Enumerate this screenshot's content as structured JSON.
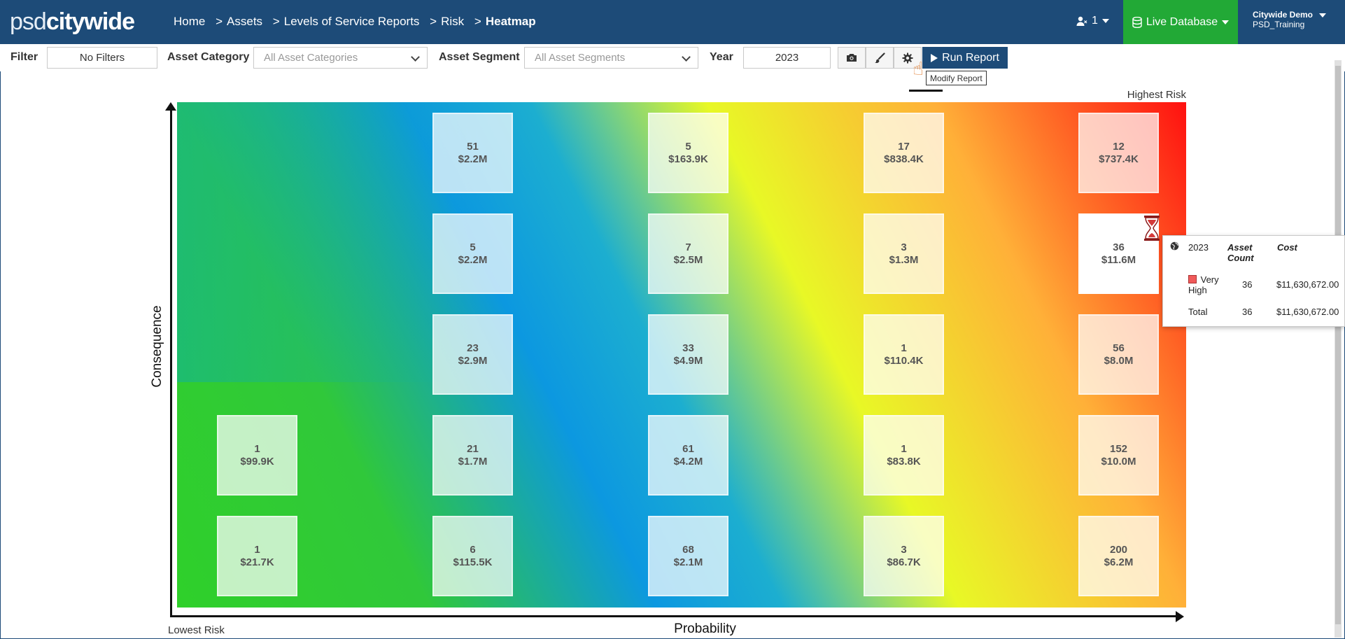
{
  "header": {
    "logo_part1": "psd",
    "logo_part2": "citywide",
    "breadcrumbs": [
      {
        "label": "Home"
      },
      {
        "label": "Assets"
      },
      {
        "label": "Levels of Service Reports"
      },
      {
        "label": "Risk"
      },
      {
        "label": "Heatmap"
      }
    ],
    "crumb_sep": ">",
    "user_count": "1",
    "database_label": "Live Database",
    "account_name": "Citywide Demo",
    "account_sub": "PSD_Training"
  },
  "toolbar": {
    "filter_label": "Filter",
    "filter_value": "No Filters",
    "asset_category_label": "Asset Category",
    "asset_category_placeholder": "All Asset Categories",
    "asset_segment_label": "Asset Segment",
    "asset_segment_placeholder": "All Asset Segments",
    "year_label": "Year",
    "year_value": "2023",
    "run_report_label": "Run Report",
    "tooltip": "Modify Report"
  },
  "heatmap": {
    "y_axis_label": "Consequence",
    "x_axis_label": "Probability",
    "highest_label": "Highest Risk",
    "lowest_label": "Lowest Risk",
    "rows": [
      [
        null,
        {
          "count": "51",
          "cost": "$2.2M"
        },
        {
          "count": "5",
          "cost": "$163.9K"
        },
        {
          "count": "17",
          "cost": "$838.4K"
        },
        {
          "count": "12",
          "cost": "$737.4K"
        }
      ],
      [
        null,
        {
          "count": "5",
          "cost": "$2.2M"
        },
        {
          "count": "7",
          "cost": "$2.5M"
        },
        {
          "count": "3",
          "cost": "$1.3M"
        },
        {
          "count": "36",
          "cost": "$11.6M",
          "highlighted": true
        }
      ],
      [
        null,
        {
          "count": "23",
          "cost": "$2.9M"
        },
        {
          "count": "33",
          "cost": "$4.9M"
        },
        {
          "count": "1",
          "cost": "$110.4K"
        },
        {
          "count": "56",
          "cost": "$8.0M"
        }
      ],
      [
        {
          "count": "1",
          "cost": "$99.9K"
        },
        {
          "count": "21",
          "cost": "$1.7M"
        },
        {
          "count": "61",
          "cost": "$4.2M"
        },
        {
          "count": "1",
          "cost": "$83.8K"
        },
        {
          "count": "152",
          "cost": "$10.0M"
        }
      ],
      [
        {
          "count": "1",
          "cost": "$21.7K"
        },
        {
          "count": "6",
          "cost": "$115.5K"
        },
        {
          "count": "68",
          "cost": "$2.1M"
        },
        {
          "count": "3",
          "cost": "$86.7K"
        },
        {
          "count": "200",
          "cost": "$6.2M"
        }
      ]
    ]
  },
  "popup": {
    "year": "2023",
    "col_count_line1": "Asset",
    "col_count_line2": "Count",
    "col_cost": "Cost",
    "row_label_line1": "Very",
    "row_label_line2": "High",
    "row_color": "#f05a5a",
    "row_count": "36",
    "row_cost": "$11,630,672.00",
    "total_label": "Total",
    "total_count": "36",
    "total_cost": "$11,630,672.00"
  },
  "icons": {
    "camera": "camera-icon",
    "brush": "brush-icon",
    "gear": "gear-icon",
    "play": "play-icon",
    "database": "database-icon",
    "user": "user-icon",
    "globe": "globe-icon",
    "hourglass": "hourglass-icon",
    "hand": "hand-pointer-icon"
  }
}
